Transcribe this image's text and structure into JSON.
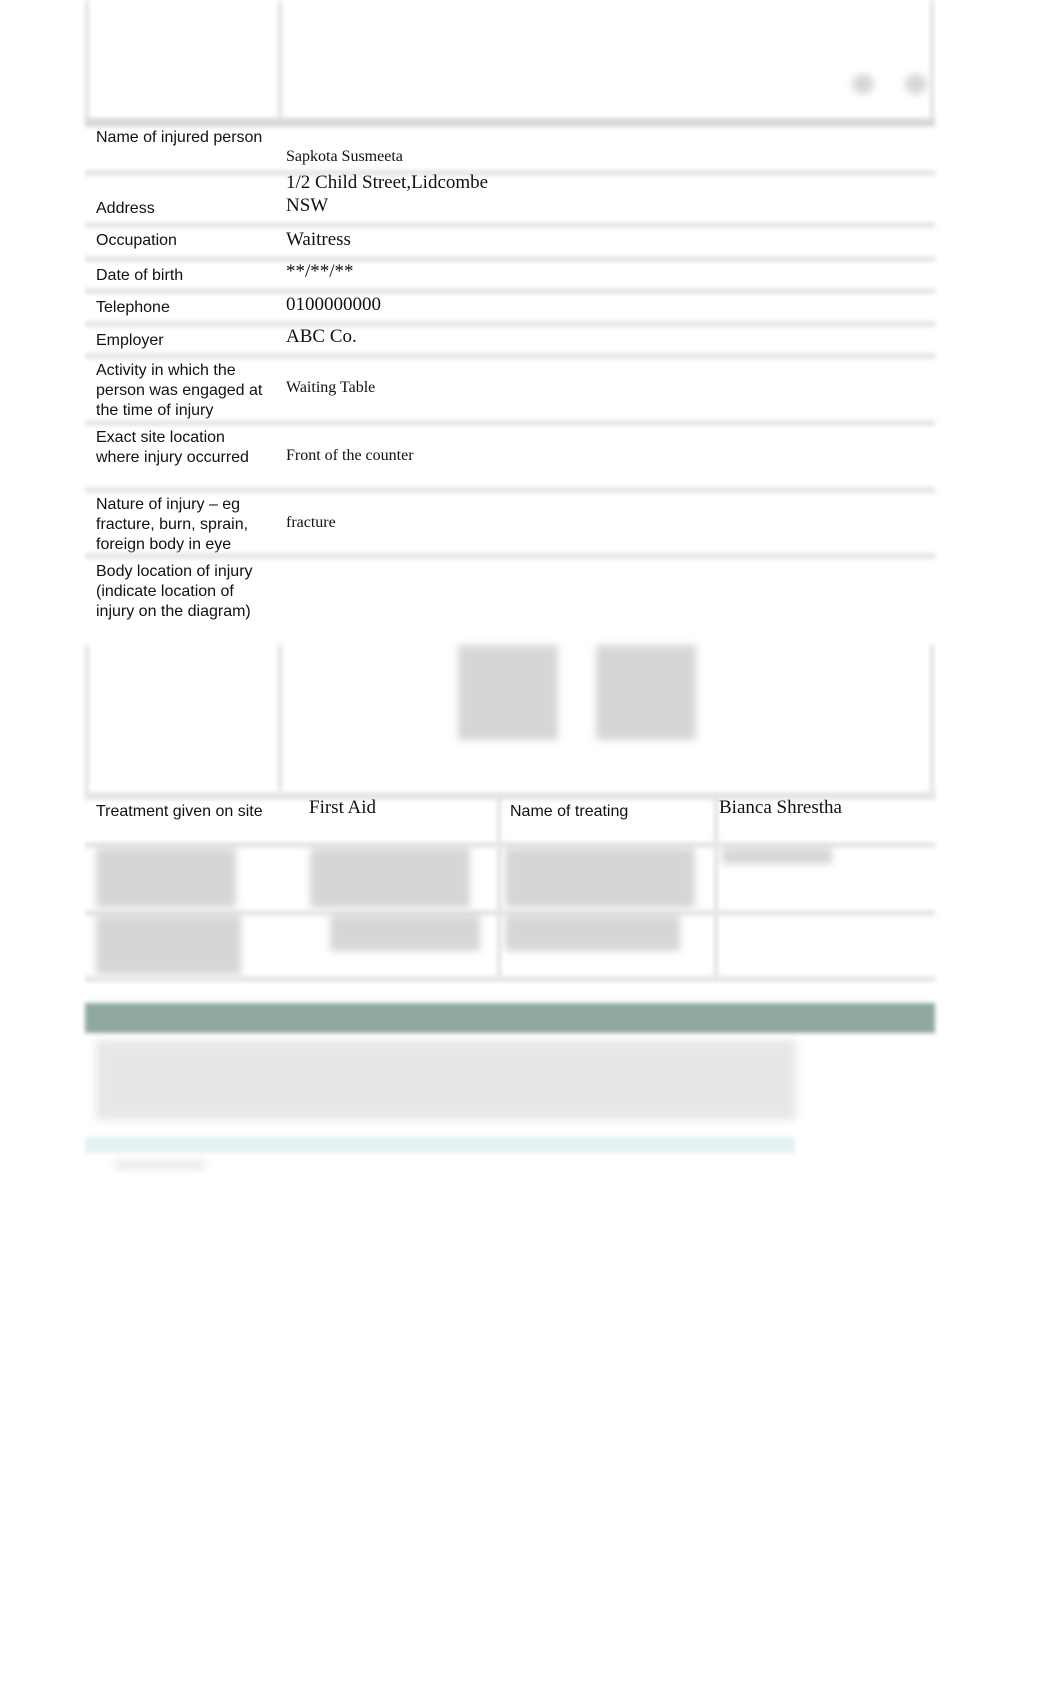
{
  "form": {
    "rows": [
      {
        "label": "Name of injured person",
        "value": "Sapkota Susmeeta"
      },
      {
        "label": "Address",
        "value": "1/2 Child Street,Lidcombe NSW"
      },
      {
        "label": "Occupation",
        "value": "Waitress"
      },
      {
        "label": "Date of birth",
        "value": "**/**/**"
      },
      {
        "label": "Telephone",
        "value": "0100000000"
      },
      {
        "label": "Employer",
        "value": "ABC Co."
      },
      {
        "label": "Activity in which the person was engaged at the time of injury",
        "value": "Waiting Table"
      },
      {
        "label": "Exact site location where injury occurred",
        "value": "Front of the counter"
      },
      {
        "label": "Nature of injury – eg fracture, burn, sprain, foreign body in eye",
        "value": "fracture"
      },
      {
        "label": "Body location of injury (indicate location of injury on the diagram)",
        "value": ""
      }
    ],
    "treatment": {
      "label": "Treatment given on site",
      "value": "First Aid",
      "treater_label": "Name of treating",
      "treater_value": "Bianca Shrestha"
    }
  },
  "colors": {
    "section_bar": "#8fa8a0",
    "footer_bar": "#e3f1f1",
    "grid": "#e6e6e6"
  }
}
